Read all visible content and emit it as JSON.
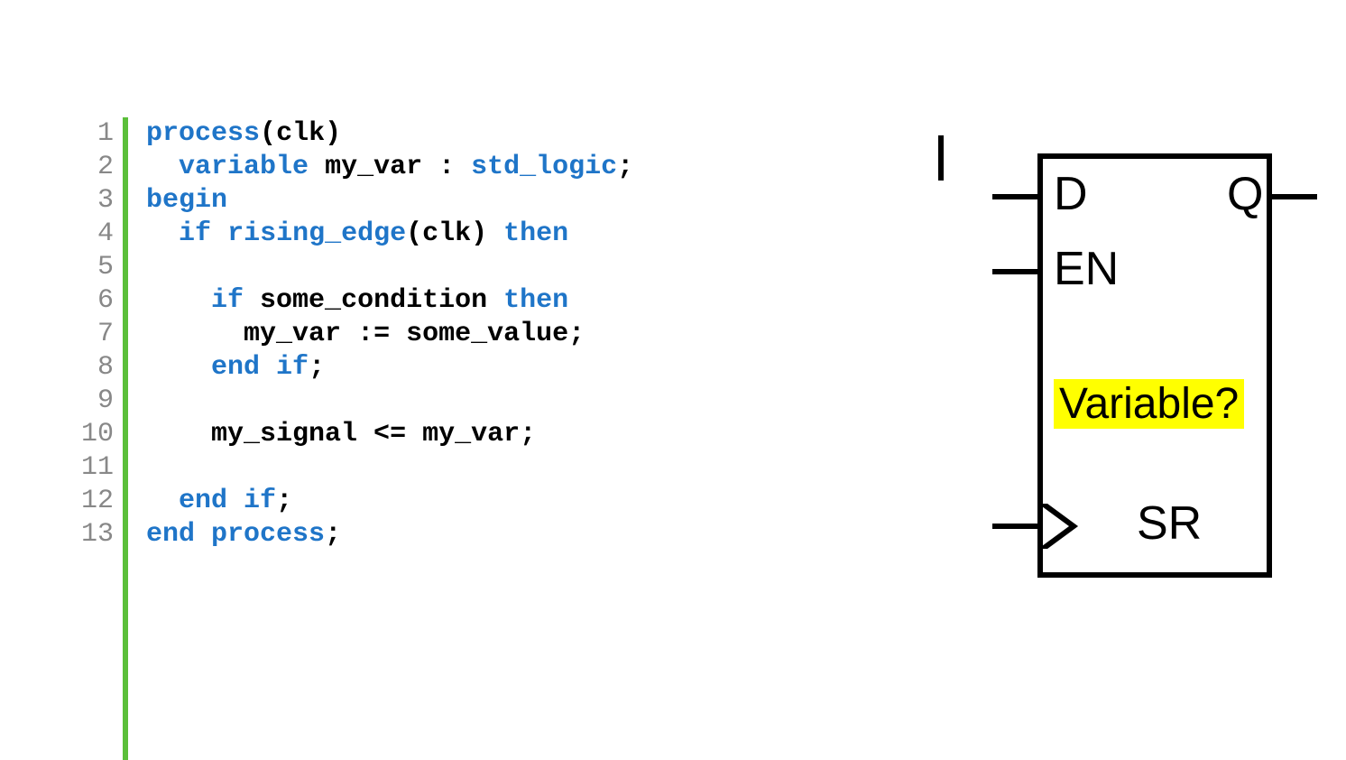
{
  "code": {
    "line_numbers": [
      "1",
      "2",
      "3",
      "4",
      "5",
      "6",
      "7",
      "8",
      "9",
      "10",
      "11",
      "12",
      "13"
    ],
    "lines": [
      {
        "indent": "",
        "tokens": [
          {
            "t": "process",
            "c": "kw"
          },
          {
            "t": "(",
            "c": "punc"
          },
          {
            "t": "clk",
            "c": "plain"
          },
          {
            "t": ")",
            "c": "punc"
          }
        ]
      },
      {
        "indent": "  ",
        "tokens": [
          {
            "t": "variable",
            "c": "kw"
          },
          {
            "t": " my_var : ",
            "c": "plain"
          },
          {
            "t": "std_logic",
            "c": "ty"
          },
          {
            "t": ";",
            "c": "punc"
          }
        ]
      },
      {
        "indent": "",
        "tokens": [
          {
            "t": "begin",
            "c": "kw"
          }
        ]
      },
      {
        "indent": "  ",
        "tokens": [
          {
            "t": "if",
            "c": "kw"
          },
          {
            "t": " ",
            "c": "plain"
          },
          {
            "t": "rising_edge",
            "c": "fn"
          },
          {
            "t": "(clk) ",
            "c": "plain"
          },
          {
            "t": "then",
            "c": "kw"
          }
        ]
      },
      {
        "indent": "",
        "tokens": []
      },
      {
        "indent": "    ",
        "tokens": [
          {
            "t": "if",
            "c": "kw"
          },
          {
            "t": " some_condition ",
            "c": "plain"
          },
          {
            "t": "then",
            "c": "kw"
          }
        ]
      },
      {
        "indent": "      ",
        "tokens": [
          {
            "t": "my_var := some_value;",
            "c": "plain"
          }
        ]
      },
      {
        "indent": "    ",
        "tokens": [
          {
            "t": "end if",
            "c": "kw"
          },
          {
            "t": ";",
            "c": "punc"
          }
        ]
      },
      {
        "indent": "",
        "tokens": []
      },
      {
        "indent": "    ",
        "tokens": [
          {
            "t": "my_signal <= my_var;",
            "c": "plain"
          }
        ]
      },
      {
        "indent": "",
        "tokens": []
      },
      {
        "indent": "  ",
        "tokens": [
          {
            "t": "end if",
            "c": "kw"
          },
          {
            "t": ";",
            "c": "punc"
          }
        ]
      },
      {
        "indent": "",
        "tokens": [
          {
            "t": "end process",
            "c": "kw"
          },
          {
            "t": ";",
            "c": "punc"
          }
        ]
      }
    ]
  },
  "diagram": {
    "pin_d": "D",
    "pin_q": "Q",
    "pin_en": "EN",
    "pin_sr": "SR",
    "annotation": "Variable?"
  }
}
